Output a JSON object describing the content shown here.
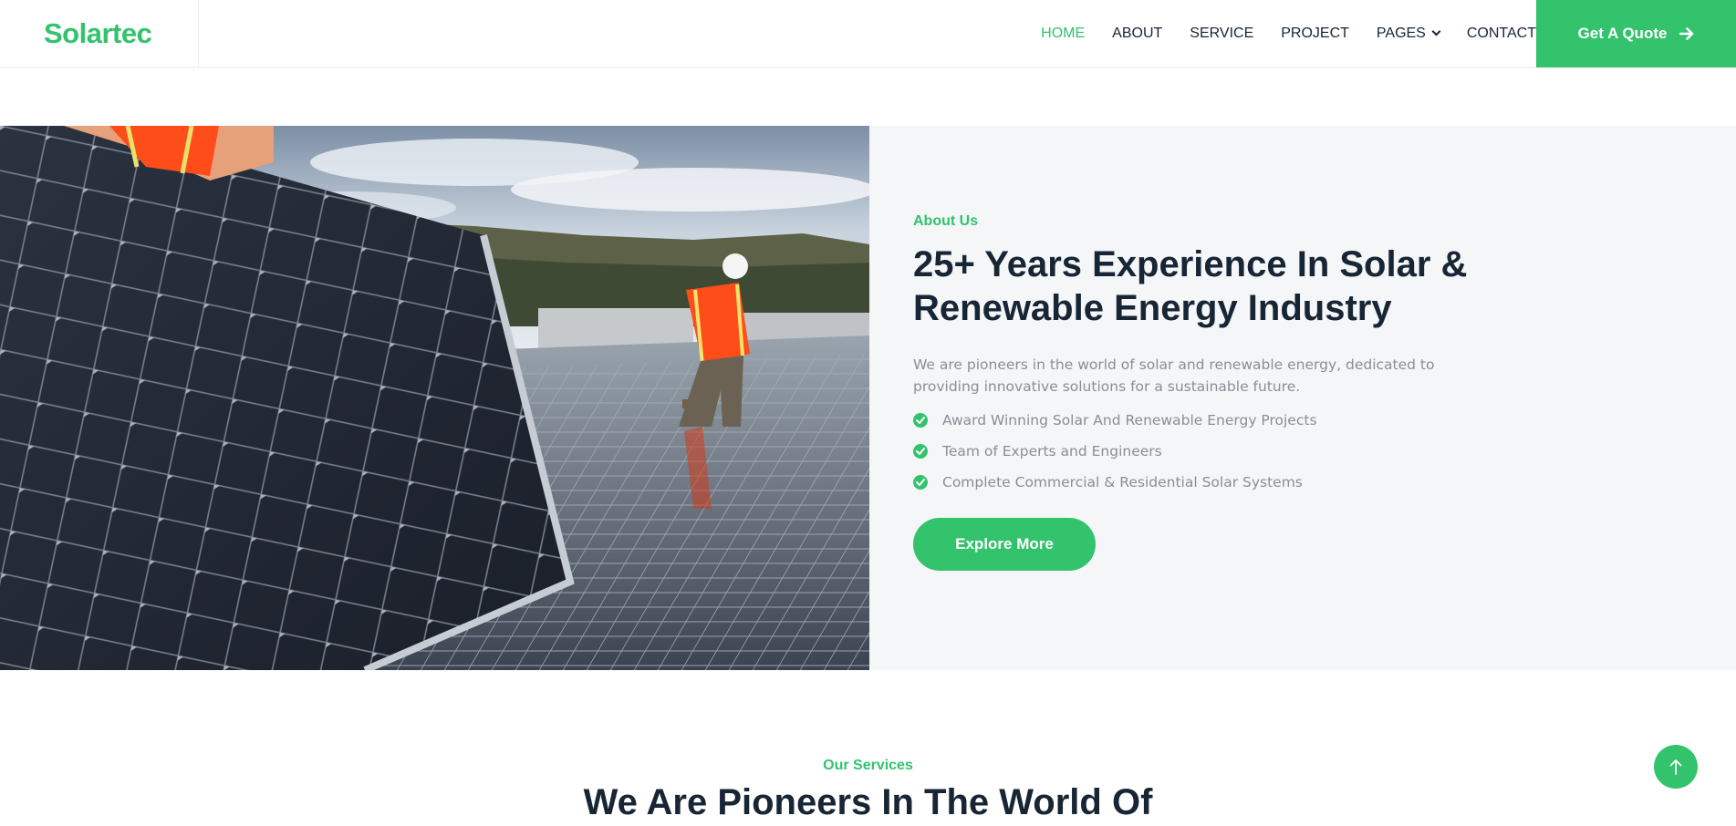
{
  "brand": {
    "name": "Solartec",
    "color": "#32c36c"
  },
  "nav": {
    "items": [
      {
        "label": "HOME",
        "active": true
      },
      {
        "label": "ABOUT",
        "active": false
      },
      {
        "label": "SERVICE",
        "active": false
      },
      {
        "label": "PROJECT",
        "active": false
      },
      {
        "label": "PAGES",
        "active": false,
        "dropdown": true
      },
      {
        "label": "CONTACT",
        "active": false
      }
    ],
    "cta_label": "Get A Quote",
    "cta_icon": "arrow-right-icon"
  },
  "about": {
    "eyebrow": "About Us",
    "heading": "25+ Years Experience In Solar & Renewable Energy Industry",
    "description": "We are pioneers in the world of solar and renewable energy, dedicated to providing innovative solutions for a sustainable future.",
    "features": [
      "Award Winning Solar And Renewable Energy Projects",
      "Team of Experts and Engineers",
      "Complete Commercial & Residential Solar Systems"
    ],
    "button_label": "Explore More",
    "image": "solar-panel-workers-photo"
  },
  "services": {
    "eyebrow": "Our Services",
    "heading": "We Are Pioneers In The World Of"
  },
  "back_to_top_icon": "arrow-up-icon",
  "colors": {
    "accent": "#32c36c",
    "dark": "#172535",
    "muted": "#8a8f96",
    "panel": "#f4f6f8"
  }
}
